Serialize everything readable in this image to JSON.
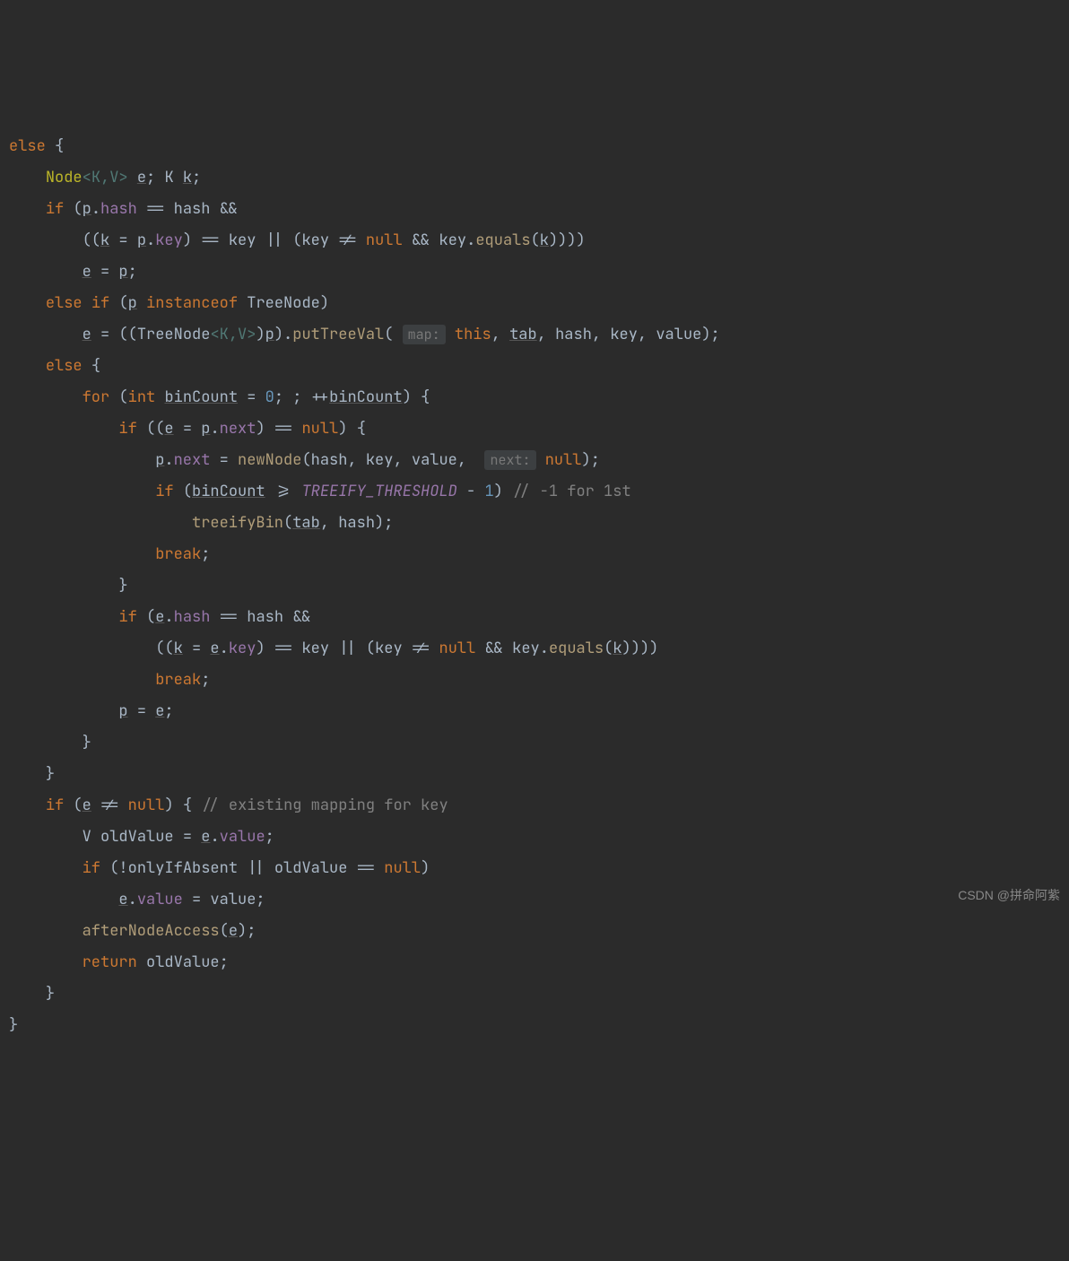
{
  "code": {
    "l1": {
      "else": "else",
      "brace": "{"
    },
    "l2": {
      "node": "Node",
      "gen": "<K,V>",
      "e": "e",
      "semi": ";",
      "K": "K",
      "k": "k"
    },
    "l3": {
      "if": "if",
      "p": "p",
      "hash": "hash",
      "eq": "==",
      "hash2": "hash",
      "amp": "&&"
    },
    "l4": {
      "k": "k",
      "eq1": "=",
      "p": "p",
      "key": "key",
      "eq2": "==",
      "key2": "key",
      "or": "||",
      "key3": "key",
      "ne": "!=",
      "null": "null",
      "amp": "&&",
      "key4": "key",
      "equals": "equals",
      "k2": "k"
    },
    "l5": {
      "e": "e",
      "eq": "=",
      "p": "p"
    },
    "l6": {
      "else": "else",
      "if": "if",
      "p": "p",
      "instanceof": "instanceof",
      "treenode": "TreeNode"
    },
    "l7": {
      "e": "e",
      "eq": "=",
      "treenode": "TreeNode",
      "gen": "<K,V>",
      "p": "p",
      "putTreeVal": "putTreeVal",
      "hint": "map:",
      "this": "this",
      "tab": "tab",
      "hash": "hash",
      "key": "key",
      "value": "value"
    },
    "l8": {
      "else": "else",
      "brace": "{"
    },
    "l9": {
      "for": "for",
      "int": "int",
      "binCount": "binCount",
      "eq": "=",
      "zero": "0",
      "plus": "++",
      "binCount2": "binCount",
      "brace": "{"
    },
    "l10": {
      "if": "if",
      "e": "e",
      "eq1": "=",
      "p": "p",
      "next": "next",
      "eq2": "==",
      "null": "null",
      "brace": "{"
    },
    "l11": {
      "p": "p",
      "next": "next",
      "eq": "=",
      "newNode": "newNode",
      "hash": "hash",
      "key": "key",
      "value": "value",
      "hint": "next:",
      "null": "null"
    },
    "l12": {
      "if": "if",
      "binCount": "binCount",
      "ge": ">=",
      "const": "TREEIFY_THRESHOLD",
      "minus": "-",
      "one": "1",
      "comment": "// -1 for 1st"
    },
    "l13": {
      "treeifyBin": "treeifyBin",
      "tab": "tab",
      "hash": "hash"
    },
    "l14": {
      "break": "break"
    },
    "l15": {
      "brace": "}"
    },
    "l16": {
      "if": "if",
      "e": "e",
      "hash": "hash",
      "eq": "==",
      "hash2": "hash",
      "amp": "&&"
    },
    "l17": {
      "k": "k",
      "eq1": "=",
      "e": "e",
      "key": "key",
      "eq2": "==",
      "key2": "key",
      "or": "||",
      "key3": "key",
      "ne": "!=",
      "null": "null",
      "amp": "&&",
      "key4": "key",
      "equals": "equals",
      "k2": "k"
    },
    "l18": {
      "break": "break"
    },
    "l19": {
      "p": "p",
      "eq": "=",
      "e": "e"
    },
    "l20": {
      "brace": "}"
    },
    "l21": {
      "brace": "}"
    },
    "l22": {
      "if": "if",
      "e": "e",
      "ne": "!=",
      "null": "null",
      "brace": "{",
      "comment": "// existing mapping for key"
    },
    "l23": {
      "V": "V",
      "oldValue": "oldValue",
      "eq": "=",
      "e": "e",
      "value": "value"
    },
    "l24": {
      "if": "if",
      "not": "!",
      "onlyIfAbsent": "onlyIfAbsent",
      "or": "||",
      "oldValue": "oldValue",
      "eq": "==",
      "null": "null"
    },
    "l25": {
      "e": "e",
      "value": "value",
      "eq": "=",
      "value2": "value"
    },
    "l26": {
      "afterNodeAccess": "afterNodeAccess",
      "e": "e"
    },
    "l27": {
      "return": "return",
      "oldValue": "oldValue"
    },
    "l28": {
      "brace": "}"
    },
    "l29": {
      "brace": "}"
    }
  },
  "watermark": "CSDN @拼命阿紫"
}
